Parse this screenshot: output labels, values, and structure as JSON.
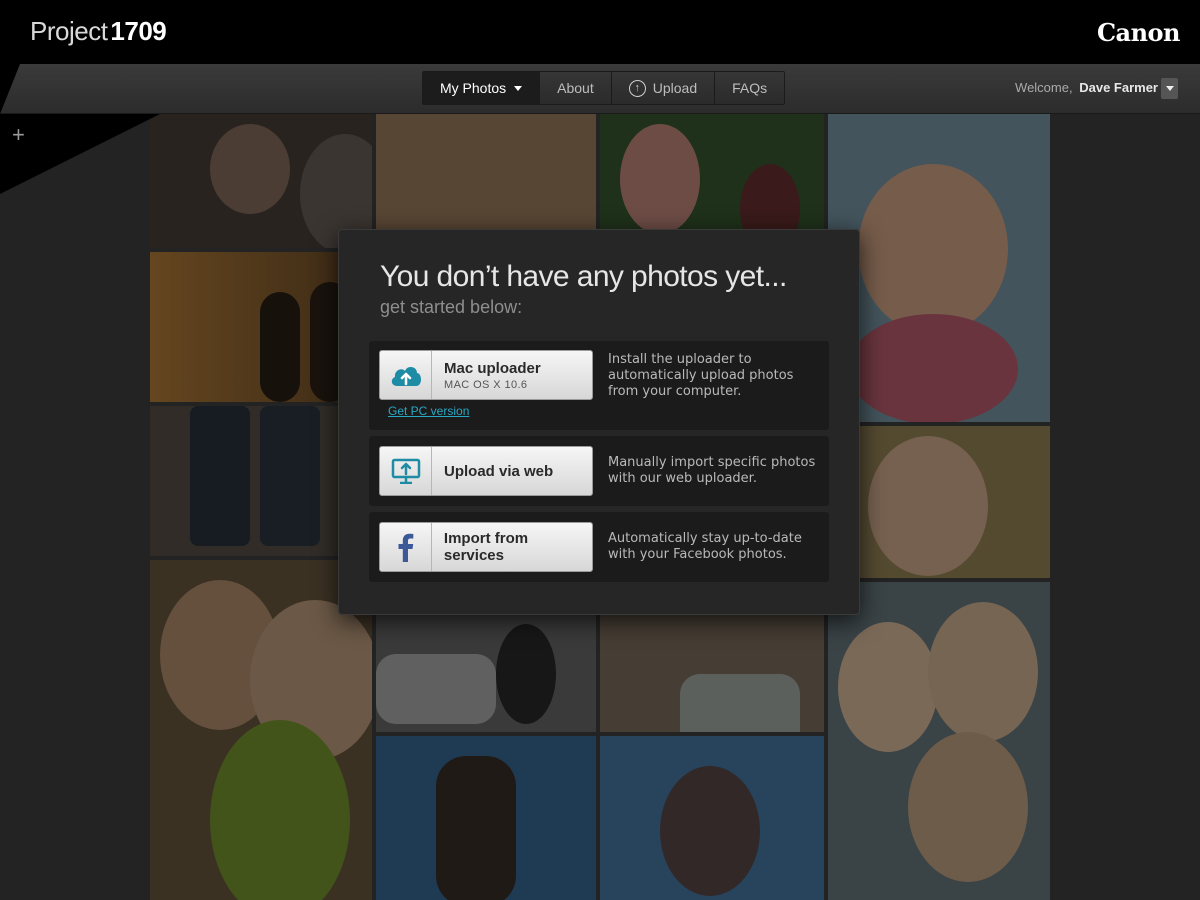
{
  "header": {
    "logo_part1": "Project",
    "logo_part2": "1709",
    "brand": "Canon"
  },
  "nav": {
    "items": [
      {
        "label": "My Photos",
        "active": true
      },
      {
        "label": "About"
      },
      {
        "label": "Upload",
        "icon": "upload-circle-icon"
      },
      {
        "label": "FAQs"
      }
    ]
  },
  "user": {
    "welcome_label": "Welcome,",
    "name": "Dave Farmer"
  },
  "sidebar": {
    "add_label": "+"
  },
  "modal": {
    "title": "You don’t have any photos yet...",
    "subtitle": "get started below:",
    "options": [
      {
        "label": "Mac uploader",
        "sublabel": "MAC OS X 10.6",
        "icon": "cloud-upload-icon",
        "description": "Install the uploader to automatically upload photos from your computer.",
        "link": "Get PC version"
      },
      {
        "label": "Upload via web",
        "icon": "monitor-upload-icon",
        "description": "Manually import specific photos with our web uploader."
      },
      {
        "label": "Import from services",
        "icon": "facebook-icon",
        "description": "Automatically stay up-to-date with your Facebook photos."
      }
    ]
  },
  "colors": {
    "accent": "#2aa7c4",
    "facebook": "#3b5998",
    "modal_bg": "#262626"
  }
}
